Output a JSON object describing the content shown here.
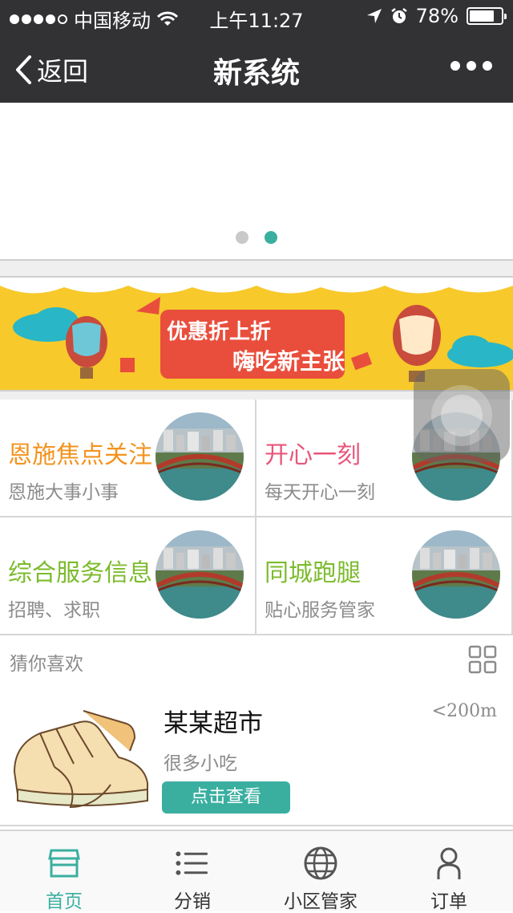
{
  "status_bar": {
    "carrier": "中国移动",
    "time": "上午11:27",
    "battery": "78%",
    "battery_level": 0.78,
    "icons": [
      "signal-dots",
      "wifi-icon",
      "location-arrow-icon",
      "alarm-icon",
      "battery-icon"
    ]
  },
  "nav": {
    "back_label": "返回",
    "title": "新系统",
    "more_icon": "ellipsis-icon"
  },
  "carousel": {
    "page_count": 2,
    "active_index": 1,
    "active_color": "#3aafa0",
    "inactive_color": "#c9c9c9"
  },
  "banner": {
    "text_line1": "优惠折上折",
    "text_line2": "嗨吃新主张",
    "bg_color": "#f7c92b"
  },
  "categories": [
    {
      "title": "恩施焦点关注",
      "subtitle": "恩施大事小事",
      "color": "#f3931f"
    },
    {
      "title": "开心一刻",
      "subtitle": "每天开心一刻",
      "color": "#e8567b"
    },
    {
      "title": "综合服务信息",
      "subtitle": "招聘、求职",
      "color": "#7cbb2d"
    },
    {
      "title": "同城跑腿",
      "subtitle": "贴心服务管家",
      "color": "#7cbb2d"
    }
  ],
  "recommend": {
    "label": "猜你喜欢",
    "view_icon": "grid-view-icon",
    "item": {
      "name": "某某超市",
      "desc": "很多小吃",
      "distance": "<200m",
      "button": "点击查看"
    }
  },
  "tabbar": {
    "active_color": "#3aafa0",
    "tabs": [
      {
        "label": "首页",
        "icon": "store-icon",
        "active": true
      },
      {
        "label": "分销",
        "icon": "list-icon",
        "active": false
      },
      {
        "label": "小区管家",
        "icon": "globe-icon",
        "active": false
      },
      {
        "label": "订单",
        "icon": "user-icon",
        "active": false
      }
    ]
  }
}
